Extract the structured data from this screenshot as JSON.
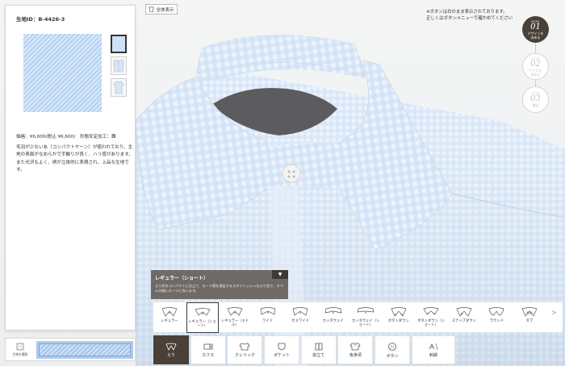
{
  "fabric_panel": {
    "fabric_id_label": "生地ID：B-4426-3",
    "price_line": "価格：¥6,000(税込 ¥6,600)　形態安定加工：難",
    "description": "毛羽が少ない糸（コンパクトヤーン）が使われており、生地の表面がなめらかで手触りが良く、ハリ感があります。また光沢もよく、柄が立体的に表現され、上品な生地です。"
  },
  "toolbar": {
    "full_view_label": "全体表示",
    "notice_line1": "※ボタンは白のまま表示されております。",
    "notice_line2": "正しくはボタンメニューで確かめてください"
  },
  "steps": [
    {
      "label": "STEP",
      "number": "01",
      "text": "デザインを\n決める",
      "active": true
    },
    {
      "label": "STEP",
      "number": "02",
      "text": "サイズを\n決める",
      "active": false
    },
    {
      "label": "STEP",
      "number": "03",
      "text": "確認",
      "active": false
    }
  ],
  "tooltip": {
    "title": "レギュラー（ショート）",
    "description": "えり先をコンパクトに仕立て、モード感を演出するスタイリッシュなえり型で、ラペルの細いスーツに合います。",
    "toggle_icon": "▼"
  },
  "collar_options": [
    {
      "label": "レギュラー",
      "selected": false
    },
    {
      "label": "レギュラー（ショート）",
      "selected": true
    },
    {
      "label": "レギュラー（ミドル）",
      "selected": false
    },
    {
      "label": "ワイド",
      "selected": false
    },
    {
      "label": "セミワイド",
      "selected": false
    },
    {
      "label": "カッタウェイ",
      "selected": false
    },
    {
      "label": "カッタウェイ（ショート）",
      "selected": false
    },
    {
      "label": "ボタンダウン",
      "selected": false
    },
    {
      "label": "ボタンダウン（ショート）",
      "selected": false
    },
    {
      "label": "スナップダウン",
      "selected": false
    },
    {
      "label": "ラウンド",
      "selected": false
    },
    {
      "label": "タブ",
      "selected": false
    }
  ],
  "strip_next_icon": "＞",
  "fabric_selector": {
    "label": "生地を選択"
  },
  "tabs": [
    {
      "label": "えり",
      "active": true
    },
    {
      "label": "カフス",
      "active": false
    },
    {
      "label": "クレリック",
      "active": false
    },
    {
      "label": "ポケット",
      "active": false
    },
    {
      "label": "前立て",
      "active": false
    },
    {
      "label": "後身頃",
      "active": false
    },
    {
      "label": "ボタン",
      "active": false
    },
    {
      "label": "刺繍",
      "active": false
    }
  ],
  "colors": {
    "accent_dark": "#4a4038",
    "fabric_blue": "#b5d2f3",
    "tooltip_bg": "#6f6a66"
  }
}
